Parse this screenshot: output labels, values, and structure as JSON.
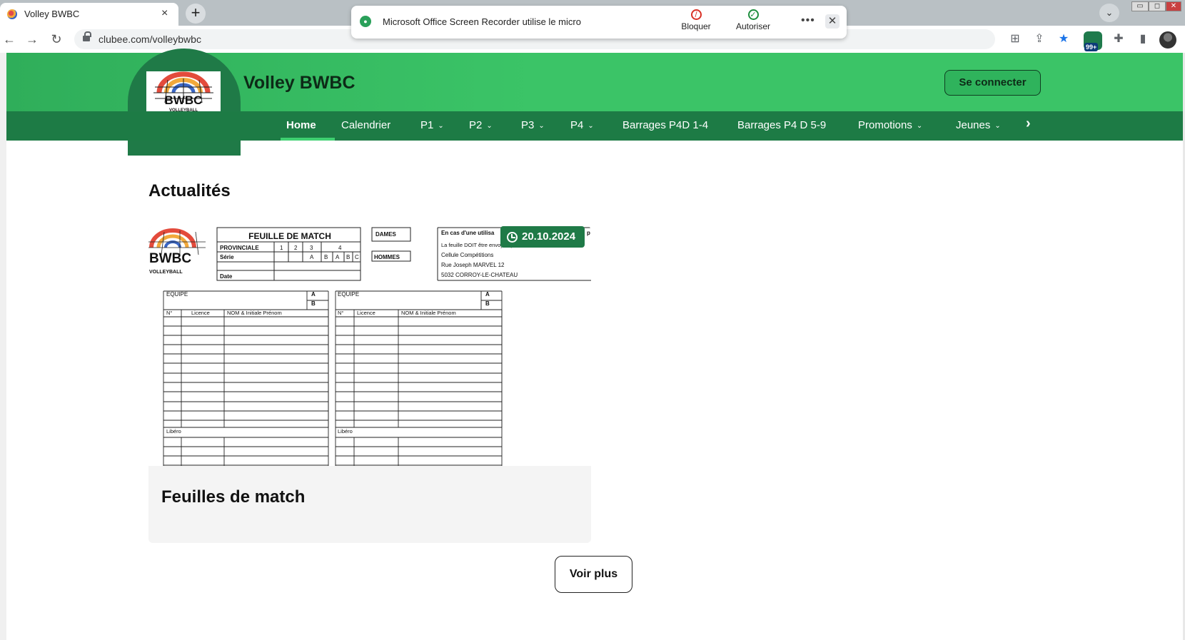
{
  "browser": {
    "tab_title": "Volley BWBC",
    "tab_close": "×",
    "new_tab": "+",
    "tab_search": "⌄",
    "url": "clubee.com/volleybwbc",
    "ext_badge": "99+",
    "window_controls": [
      "▭",
      "◻",
      "✕"
    ]
  },
  "permission_popup": {
    "app": "Microsoft Office Screen Recorder",
    "message_suffix": "utilise le micro",
    "block_label": "Bloquer",
    "allow_label": "Autoriser",
    "more": "•••",
    "close": "✕"
  },
  "site": {
    "title": "Volley BWBC",
    "login_label": "Se connecter",
    "nav": [
      {
        "label": "Home",
        "dropdown": false,
        "active": true
      },
      {
        "label": "Calendrier",
        "dropdown": false
      },
      {
        "label": "P1",
        "dropdown": true
      },
      {
        "label": "P2",
        "dropdown": true
      },
      {
        "label": "P3",
        "dropdown": true
      },
      {
        "label": "P4",
        "dropdown": true
      },
      {
        "label": "Barrages P4D 1-4",
        "dropdown": false
      },
      {
        "label": "Barrages P4 D 5-9",
        "dropdown": false
      },
      {
        "label": "Promotions",
        "dropdown": true
      },
      {
        "label": "Jeunes",
        "dropdown": true
      }
    ],
    "nav_next": "›",
    "chevron": "⌄"
  },
  "news": {
    "section_title": "Actualités",
    "card": {
      "date": "20.10.2024",
      "title": "Feuilles de match",
      "sheet": {
        "heading": "FEUILLE DE MATCH",
        "provinciale": "PROVINCIALE",
        "serie": "Série",
        "date_label": "Date",
        "cols": [
          "1",
          "2",
          "3",
          "4"
        ],
        "serie_cols": [
          "A",
          "B",
          "A",
          "B",
          "C"
        ],
        "dames": "DAMES",
        "hommes": "HOMMES",
        "notice_line1": "En cas d'une utilisa",
        "notice_line1_end": "p",
        "notice_line2": "La feuille DOIT être envoyée par COURRIER POST",
        "address": [
          "Cellule Compétitions",
          "Rue Joseph MARVEL 12",
          "5032 CORROY-LE-CHATEAU"
        ],
        "logo_text": "BWBC",
        "logo_sub": "VOLLEYBALL",
        "equipe": "EQUIPE",
        "team_a": "A",
        "team_b": "B",
        "col_no": "N°",
        "col_licence": "Licence",
        "col_nom": "NOM & Initiale Prénom",
        "libero": "Libéro"
      }
    },
    "more_label": "Voir plus"
  },
  "colors": {
    "header_green": "#3bc467",
    "nav_green": "#1d7b45",
    "badge_green": "#1f7a47"
  }
}
